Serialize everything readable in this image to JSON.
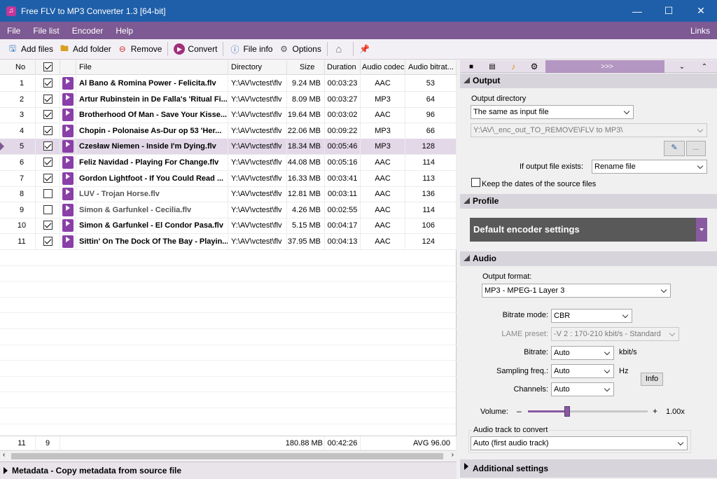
{
  "window": {
    "title": "Free FLV to MP3 Converter 1.3  [64-bit]",
    "app_icon": "music-note-icon"
  },
  "menu": {
    "items": [
      "File",
      "File list",
      "Encoder",
      "Help"
    ],
    "links": "Links"
  },
  "toolbar": {
    "add_files": "Add files",
    "add_folder": "Add folder",
    "remove": "Remove",
    "convert": "Convert",
    "file_info": "File info",
    "options": "Options"
  },
  "grid": {
    "columns": [
      "No",
      "",
      "",
      "File",
      "Directory",
      "Size",
      "Duration",
      "Audio codec",
      "Audio bitrat..."
    ],
    "rows": [
      {
        "no": "1",
        "checked": true,
        "file": "Al Bano & Romina Power - Felicita.flv",
        "dir": "Y:\\AV\\vctest\\flv",
        "size": "9.24 MB",
        "duration": "00:03:23",
        "codec": "AAC",
        "bitrate": "53"
      },
      {
        "no": "2",
        "checked": true,
        "file": "Artur Rubinstein in De Falla's 'Ritual Fi...",
        "dir": "Y:\\AV\\vctest\\flv",
        "size": "8.09 MB",
        "duration": "00:03:27",
        "codec": "MP3",
        "bitrate": "64"
      },
      {
        "no": "3",
        "checked": true,
        "file": "Brotherhood Of Man - Save Your Kisse...",
        "dir": "Y:\\AV\\vctest\\flv",
        "size": "19.64 MB",
        "duration": "00:03:02",
        "codec": "AAC",
        "bitrate": "96"
      },
      {
        "no": "4",
        "checked": true,
        "file": "Chopin - Polonaise As-Dur op 53 'Her...",
        "dir": "Y:\\AV\\vctest\\flv",
        "size": "22.06 MB",
        "duration": "00:09:22",
        "codec": "MP3",
        "bitrate": "66"
      },
      {
        "no": "5",
        "checked": true,
        "file": "Czesław Niemen - Inside I'm Dying.flv",
        "dir": "Y:\\AV\\vctest\\flv",
        "size": "18.34 MB",
        "duration": "00:05:46",
        "codec": "MP3",
        "bitrate": "128",
        "selected": true
      },
      {
        "no": "6",
        "checked": true,
        "file": "Feliz Navidad - Playing For Change.flv",
        "dir": "Y:\\AV\\vctest\\flv",
        "size": "44.08 MB",
        "duration": "00:05:16",
        "codec": "AAC",
        "bitrate": "114"
      },
      {
        "no": "7",
        "checked": true,
        "file": "Gordon Lightfoot - If You Could Read ...",
        "dir": "Y:\\AV\\vctest\\flv",
        "size": "16.33 MB",
        "duration": "00:03:41",
        "codec": "AAC",
        "bitrate": "113"
      },
      {
        "no": "8",
        "checked": false,
        "file": "LUV - Trojan Horse.flv",
        "dir": "Y:\\AV\\vctest\\flv",
        "size": "12.81 MB",
        "duration": "00:03:11",
        "codec": "AAC",
        "bitrate": "136"
      },
      {
        "no": "9",
        "checked": false,
        "file": "Simon & Garfunkel - Cecilia.flv",
        "dir": "Y:\\AV\\vctest\\flv",
        "size": "4.26 MB",
        "duration": "00:02:55",
        "codec": "AAC",
        "bitrate": "114"
      },
      {
        "no": "10",
        "checked": true,
        "file": "Simon & Garfunkel - El Condor Pasa.flv",
        "dir": "Y:\\AV\\vctest\\flv",
        "size": "5.15 MB",
        "duration": "00:04:17",
        "codec": "AAC",
        "bitrate": "106"
      },
      {
        "no": "11",
        "checked": true,
        "file": "Sittin' On The Dock Of The Bay - Playin...",
        "dir": "Y:\\AV\\vctest\\flv",
        "size": "37.95 MB",
        "duration": "00:04:13",
        "codec": "AAC",
        "bitrate": "124"
      }
    ],
    "footer": {
      "count": "11",
      "checked": "9",
      "size": "180.88 MB",
      "duration": "00:42:26",
      "bitrate": "AVG  96.00"
    }
  },
  "metadata_bar": "Metadata - Copy metadata from source file",
  "right_panel": {
    "tabs_more": ">>>",
    "output": {
      "header": "Output",
      "dir_label": "Output directory",
      "dir_mode": "The same as input file",
      "dir_path": "Y:\\AV\\_enc_out_TO_REMOVE\\FLV to MP3\\",
      "browse": "...",
      "exists_label": "If output file exists:",
      "exists_value": "Rename file",
      "keep_dates": "Keep the dates of the source files"
    },
    "profile": {
      "header": "Profile",
      "value": "Default encoder settings"
    },
    "audio": {
      "header": "Audio",
      "format_label": "Output format:",
      "format_value": "MP3 - MPEG-1 Layer 3",
      "bitrate_mode_label": "Bitrate mode:",
      "bitrate_mode_value": "CBR",
      "lame_label": "LAME preset:",
      "lame_value": "-V 2 : 170-210 kbit/s - Standard",
      "bitrate_label": "Bitrate:",
      "bitrate_value": "Auto",
      "bitrate_unit": "kbit/s",
      "sampling_label": "Sampling freq.:",
      "sampling_value": "Auto",
      "sampling_unit": "Hz",
      "info_button": "Info",
      "channels_label": "Channels:",
      "channels_value": "Auto",
      "volume_label": "Volume:",
      "volume_minus": "–",
      "volume_plus": "+",
      "volume_value": "1.00x",
      "volume_fraction": 0.33,
      "track_label": "Audio track to convert",
      "track_value": "Auto (first audio track)"
    },
    "additional": "Additional settings"
  },
  "colors": {
    "titlebar": "#1f5fa9",
    "menubar": "#7d5a93",
    "accent": "#8a5aa0"
  }
}
